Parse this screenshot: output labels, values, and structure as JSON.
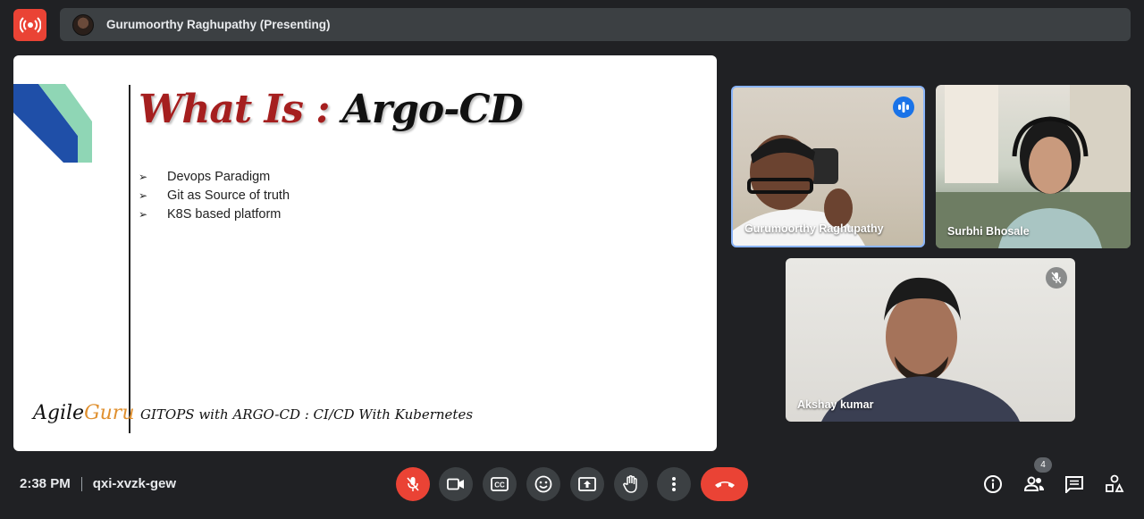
{
  "presenter_bar": {
    "name": "Gurumoorthy Raghupathy (Presenting)"
  },
  "slide": {
    "title_part1": "What Is : ",
    "title_part2": "Argo-CD",
    "bullets": [
      "Devops Paradigm",
      "Git as Source of truth",
      "K8S based platform"
    ],
    "brand_part1": "Agile",
    "brand_part2": "Guru",
    "footer": "GITOPS with ARGO-CD : CI/CD With Kubernetes"
  },
  "participants": [
    {
      "name": "Gurumoorthy Raghupathy",
      "status": "speaking"
    },
    {
      "name": "Surbhi Bhosale",
      "status": "none"
    },
    {
      "name": "Akshay kumar",
      "status": "muted"
    }
  ],
  "meeting": {
    "time": "2:38 PM",
    "code": "qxi-xvzk-gew"
  },
  "people_count": "4",
  "colors": {
    "background": "#202124",
    "panel": "#3c4043",
    "danger": "#ea4335",
    "speaking_blue": "#1a73e8",
    "active_border": "#8ab4f8",
    "title_red": "#a51f1f",
    "brand_orange": "#e0902f"
  },
  "icons": {
    "live": "live-broadcast-icon",
    "mic": "mic-off-icon",
    "camera": "camera-icon",
    "captions": "captions-icon",
    "emoji": "emoji-icon",
    "present": "present-screen-icon",
    "hand": "raise-hand-icon",
    "more": "more-options-icon",
    "hangup": "hang-up-icon",
    "info": "info-icon",
    "people": "people-icon",
    "chat": "chat-icon",
    "activities": "activities-icon"
  }
}
